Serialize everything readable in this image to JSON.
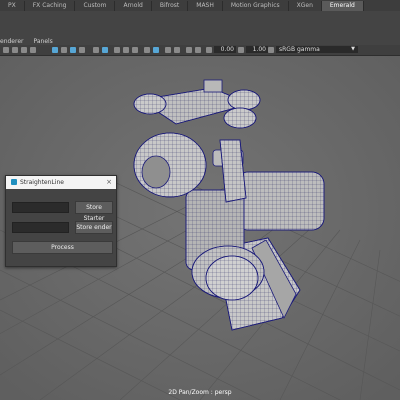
{
  "shelf_tabs": [
    "PX",
    "FX Caching",
    "Custom",
    "Arnold",
    "Bifrost",
    "MASH",
    "Motion Graphics",
    "XGen",
    "Emerald"
  ],
  "active_tab": "Emerald",
  "panel_menu": [
    "enderer",
    "Panels"
  ],
  "toolbar": {
    "value_a": "0.00",
    "value_b": "1.00",
    "color_space": "sRGB gamma"
  },
  "viewport": {
    "label": "2D Pan/Zoom : persp"
  },
  "dialog": {
    "title": "StraightenLine",
    "store_starter": "Store Starter",
    "store_ender": "Store ender",
    "process": "Process"
  }
}
